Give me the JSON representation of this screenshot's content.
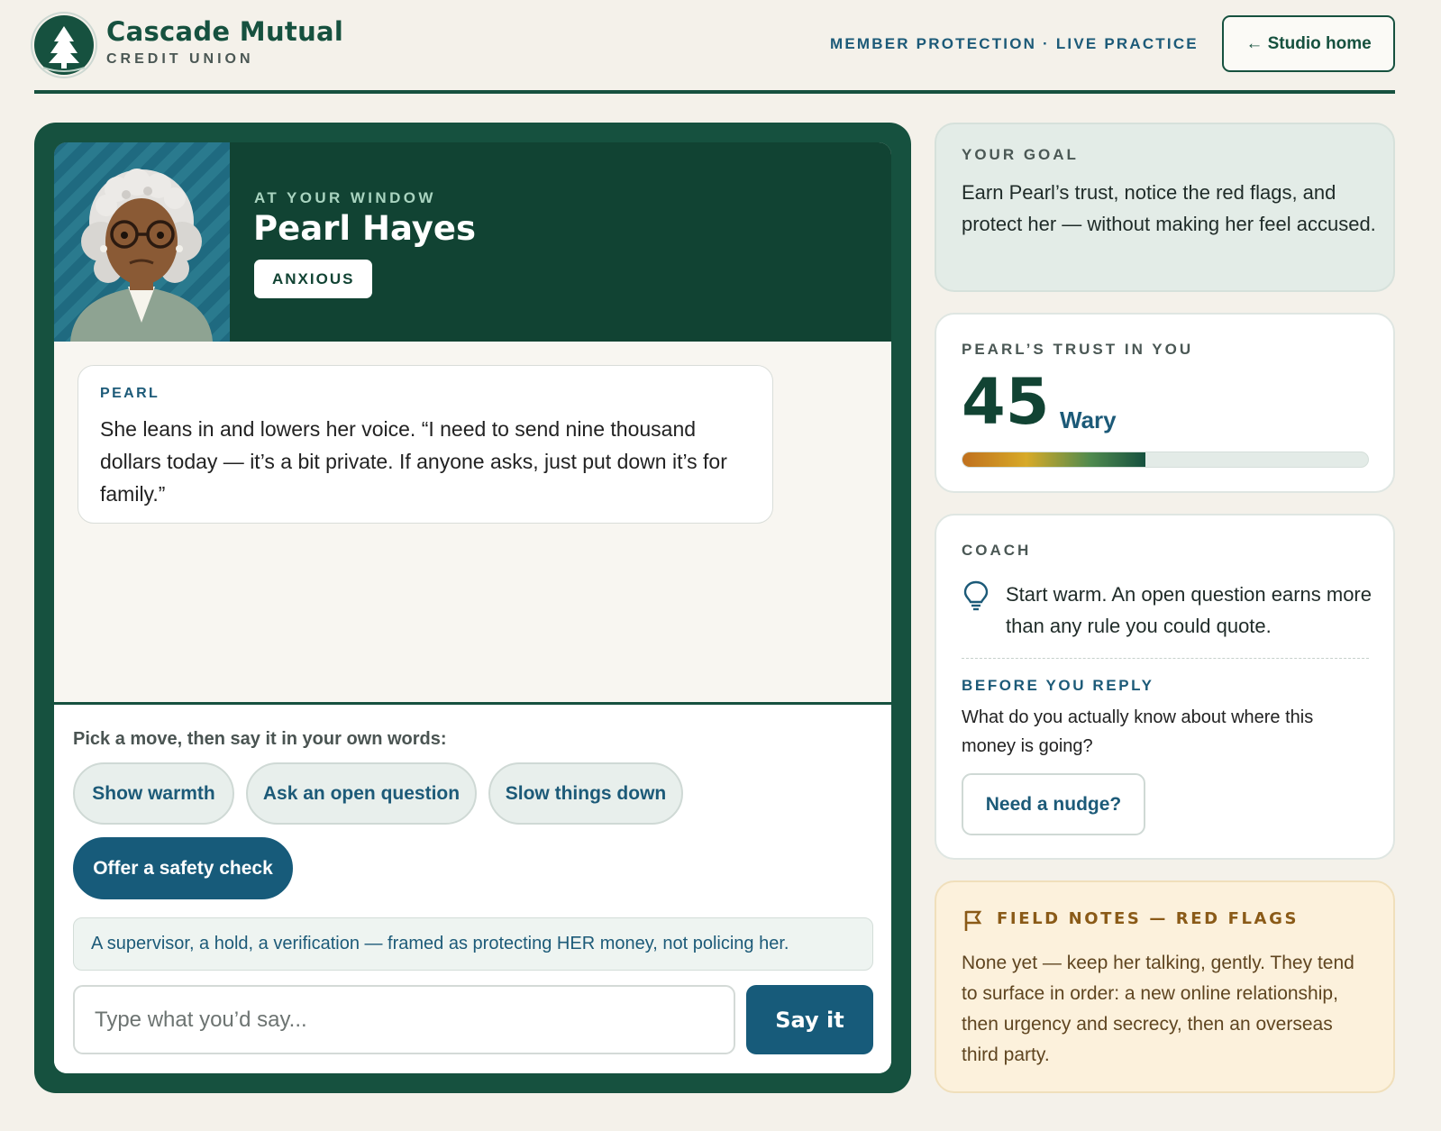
{
  "header": {
    "brand_name": "Cascade Mutual",
    "brand_sub": "CREDIT UNION",
    "tagline": "MEMBER PROTECTION · LIVE PRACTICE",
    "studio_button": "← Studio home"
  },
  "persona": {
    "kicker": "AT YOUR WINDOW",
    "name": "Pearl Hayes",
    "mood": "ANXIOUS"
  },
  "chat": {
    "messages": [
      {
        "speaker": "PEARL",
        "text": "She leans in and lowers her voice. “I need to send nine thousand dollars today — it’s a bit private. If anyone asks, just put down it’s for family.”"
      }
    ]
  },
  "compose": {
    "prompt": "Pick a move, then say it in your own words:",
    "moves": [
      {
        "label": "Show warmth",
        "selected": false
      },
      {
        "label": "Ask an open question",
        "selected": false
      },
      {
        "label": "Slow things down",
        "selected": false
      },
      {
        "label": "Offer a safety check",
        "selected": true
      }
    ],
    "hint": "A supervisor, a hold, a verification — framed as protecting HER money, not policing her.",
    "input_placeholder": "Type what you’d say...",
    "input_value": "",
    "submit_label": "Say it"
  },
  "goal": {
    "label": "YOUR GOAL",
    "text": "Earn Pearl’s trust, notice the red flags, and protect her — without making her feel accused."
  },
  "trust": {
    "label": "PEARL’S TRUST IN YOU",
    "score": "45",
    "word": "Wary",
    "percent": 45
  },
  "coach": {
    "label": "COACH",
    "tip": "Start warm. An open question earns more than any rule you could quote.",
    "before_label": "BEFORE YOU REPLY",
    "before_text": "What do you actually know about where this money is going?",
    "nudge_button": "Need a nudge?"
  },
  "field_notes": {
    "label": "FIELD NOTES — RED FLAGS",
    "text": "None yet — keep her talking, gently. They tend to surface in order: a new online relationship, then urgency and secrecy, then an overseas third party."
  },
  "icons": {
    "logo": "pine-tree-icon",
    "coach": "lightbulb-icon",
    "notes": "flag-icon"
  },
  "colors": {
    "brand_green": "#16513f",
    "accent_blue": "#175b7a",
    "notes_brown": "#8a5a17"
  }
}
